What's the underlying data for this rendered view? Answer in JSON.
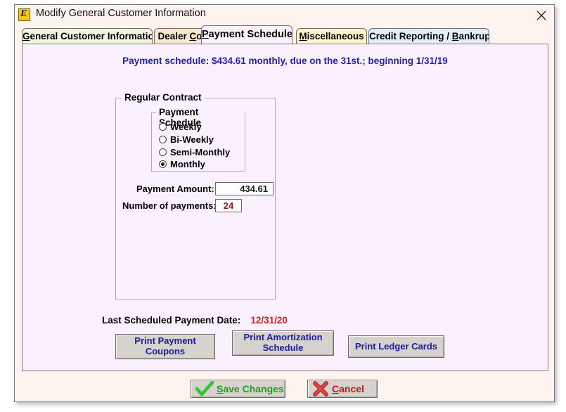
{
  "window": {
    "title": "Modify General Customer Information",
    "icon": "app-icon",
    "close_icon": "close-icon"
  },
  "tabs": [
    {
      "label": "General Customer Information",
      "accel": "G",
      "color": "#f2f5de",
      "active": false
    },
    {
      "label": "Dealer Cost",
      "accel": "C",
      "color": "#fbe7cd",
      "active": false
    },
    {
      "label": "Payment Schedule",
      "accel": "P",
      "color": "#fbf2fe",
      "active": true
    },
    {
      "label": "Miscellaneous",
      "accel": "M",
      "color": "#faf6c8",
      "active": false
    },
    {
      "label": "Credit Reporting / Bankruptcy",
      "accel": "B",
      "color": "#e4ecf8",
      "active": false
    }
  ],
  "tab_labels": {
    "general_pre": "",
    "general_accel": "G",
    "general_post": "eneral Customer Information",
    "dealer_pre": "Dealer ",
    "dealer_accel": "C",
    "dealer_post": "ost",
    "payment_accel": "P",
    "payment_post": "ayment Schedule",
    "misc_accel": "M",
    "misc_post": "iscellaneous",
    "credit_pre": "Credit Reporting / ",
    "credit_accel": "B",
    "credit_post": "ankruptcy"
  },
  "main": {
    "headline": "Payment schedule: $434.61 monthly, due on the 31st.; beginning  1/31/19",
    "headline_color": "#2222b4",
    "regular_contract_legend": "Regular Contract",
    "payment_schedule_legend": "Payment Schedule",
    "schedule_options": [
      {
        "label": "Weekly",
        "selected": false
      },
      {
        "label": "Bi-Weekly",
        "selected": false
      },
      {
        "label": "Semi-Monthly",
        "selected": false
      },
      {
        "label": "Monthly",
        "selected": true
      }
    ],
    "payment_amount_label": "Payment Amount:",
    "payment_amount_value": "434.61",
    "number_payments_label": "Number of payments:",
    "number_payments_value": "24",
    "number_payments_color": "#8b1a1a",
    "last_payment_label": "Last Scheduled Payment Date:",
    "last_payment_value": "12/31/20",
    "last_payment_color": "#cc2222"
  },
  "buttons": {
    "print_coupons_line1": "Print Payment",
    "print_coupons_line2": "Coupons",
    "print_amortization_line1": "Print Amortization",
    "print_amortization_line2": "Schedule",
    "print_ledger": "Print Ledger Cards",
    "save_accel": "S",
    "save_rest": "ave Changes",
    "save_icon": "green-check-icon",
    "cancel_accel": "C",
    "cancel_rest": "ancel",
    "cancel_icon": "red-x-icon"
  }
}
